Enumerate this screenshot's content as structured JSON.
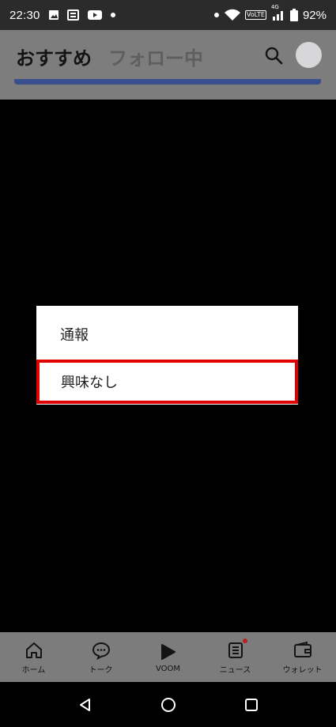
{
  "status_bar": {
    "time": "22:30",
    "battery_percent": "92%",
    "network_label": "VoLTE",
    "lte_label": "4G",
    "icons": [
      "gallery-icon",
      "news-app-icon",
      "youtube-icon",
      "dot-icon",
      "wifi-icon",
      "signal-icon",
      "battery-icon"
    ]
  },
  "header": {
    "tabs": [
      {
        "label": "おすすめ",
        "active": true
      },
      {
        "label": "フォロー中",
        "active": false
      }
    ],
    "actions": [
      "search-icon",
      "avatar"
    ]
  },
  "menu": {
    "items": [
      {
        "label": "通報"
      },
      {
        "label": "興味なし",
        "highlighted": true
      }
    ],
    "highlight_color": "#e00000"
  },
  "bottom_nav": {
    "items": [
      {
        "label": "ホーム",
        "icon": "home-icon"
      },
      {
        "label": "トーク",
        "icon": "chat-icon"
      },
      {
        "label": "VOOM",
        "icon": "voom-icon"
      },
      {
        "label": "ニュース",
        "icon": "news-icon",
        "badge": true
      },
      {
        "label": "ウォレット",
        "icon": "wallet-icon"
      }
    ]
  },
  "system_nav": [
    "back-icon",
    "home-circle-icon",
    "recents-icon"
  ],
  "colors": {
    "overlay_header": "#7d7d7d",
    "tab_indicator": "#3a4f8e",
    "news_badge": "#b52020"
  }
}
